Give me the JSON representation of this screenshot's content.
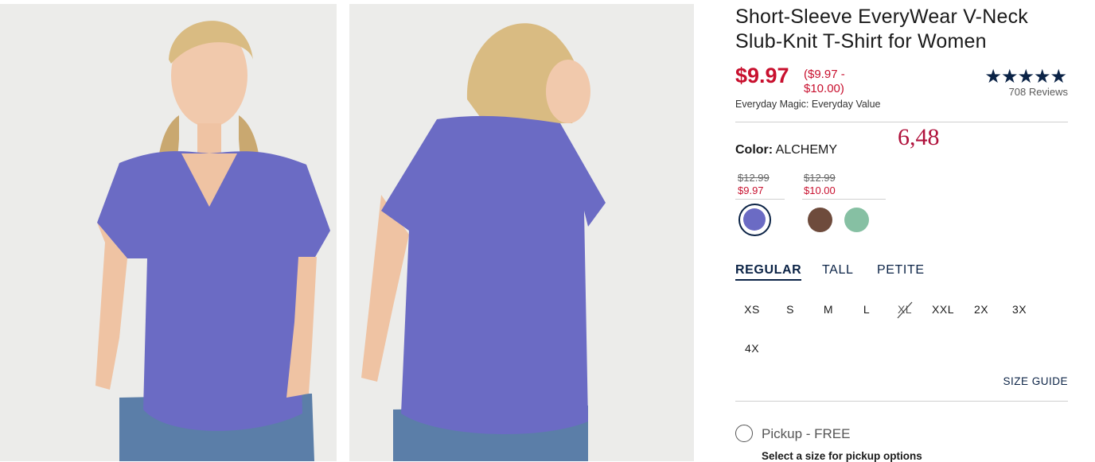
{
  "product": {
    "title": "Short-Sleeve EveryWear V-Neck Slub-Knit T-Shirt for Women",
    "price": "$9.97",
    "price_range": "($9.97 - $10.00)",
    "tagline": "Everyday Magic: Everyday Value",
    "rating": {
      "stars": "★★★★★",
      "value_out_of_5": 5,
      "reviews": "708 Reviews"
    }
  },
  "color": {
    "label": "Color:",
    "selected": "ALCHEMY",
    "annotation": "6,48",
    "price_groups": [
      {
        "was": "$12.99",
        "now": "$9.97"
      },
      {
        "was": "$12.99",
        "now": "$10.00"
      }
    ],
    "swatches": [
      {
        "name": "alchemy",
        "hex": "#6b6bc4",
        "selected": true
      },
      {
        "name": "brown",
        "hex": "#6e4b3c",
        "selected": false
      },
      {
        "name": "green",
        "hex": "#86c0a3",
        "selected": false
      }
    ]
  },
  "fit_tabs": [
    "REGULAR",
    "TALL",
    "PETITE"
  ],
  "sizes": [
    {
      "label": "XS",
      "available": true
    },
    {
      "label": "S",
      "available": true
    },
    {
      "label": "M",
      "available": true
    },
    {
      "label": "L",
      "available": true
    },
    {
      "label": "XL",
      "available": false
    },
    {
      "label": "XXL",
      "available": true
    },
    {
      "label": "2X",
      "available": true
    },
    {
      "label": "3X",
      "available": true
    },
    {
      "label": "4X",
      "available": true
    }
  ],
  "size_guide": "SIZE GUIDE",
  "pickup": {
    "label": "Pickup - FREE",
    "note": "Select a size for pickup options"
  },
  "colors": {
    "price_red": "#c8102e",
    "navy": "#0b2346",
    "shirt": "#6b6bc4"
  }
}
